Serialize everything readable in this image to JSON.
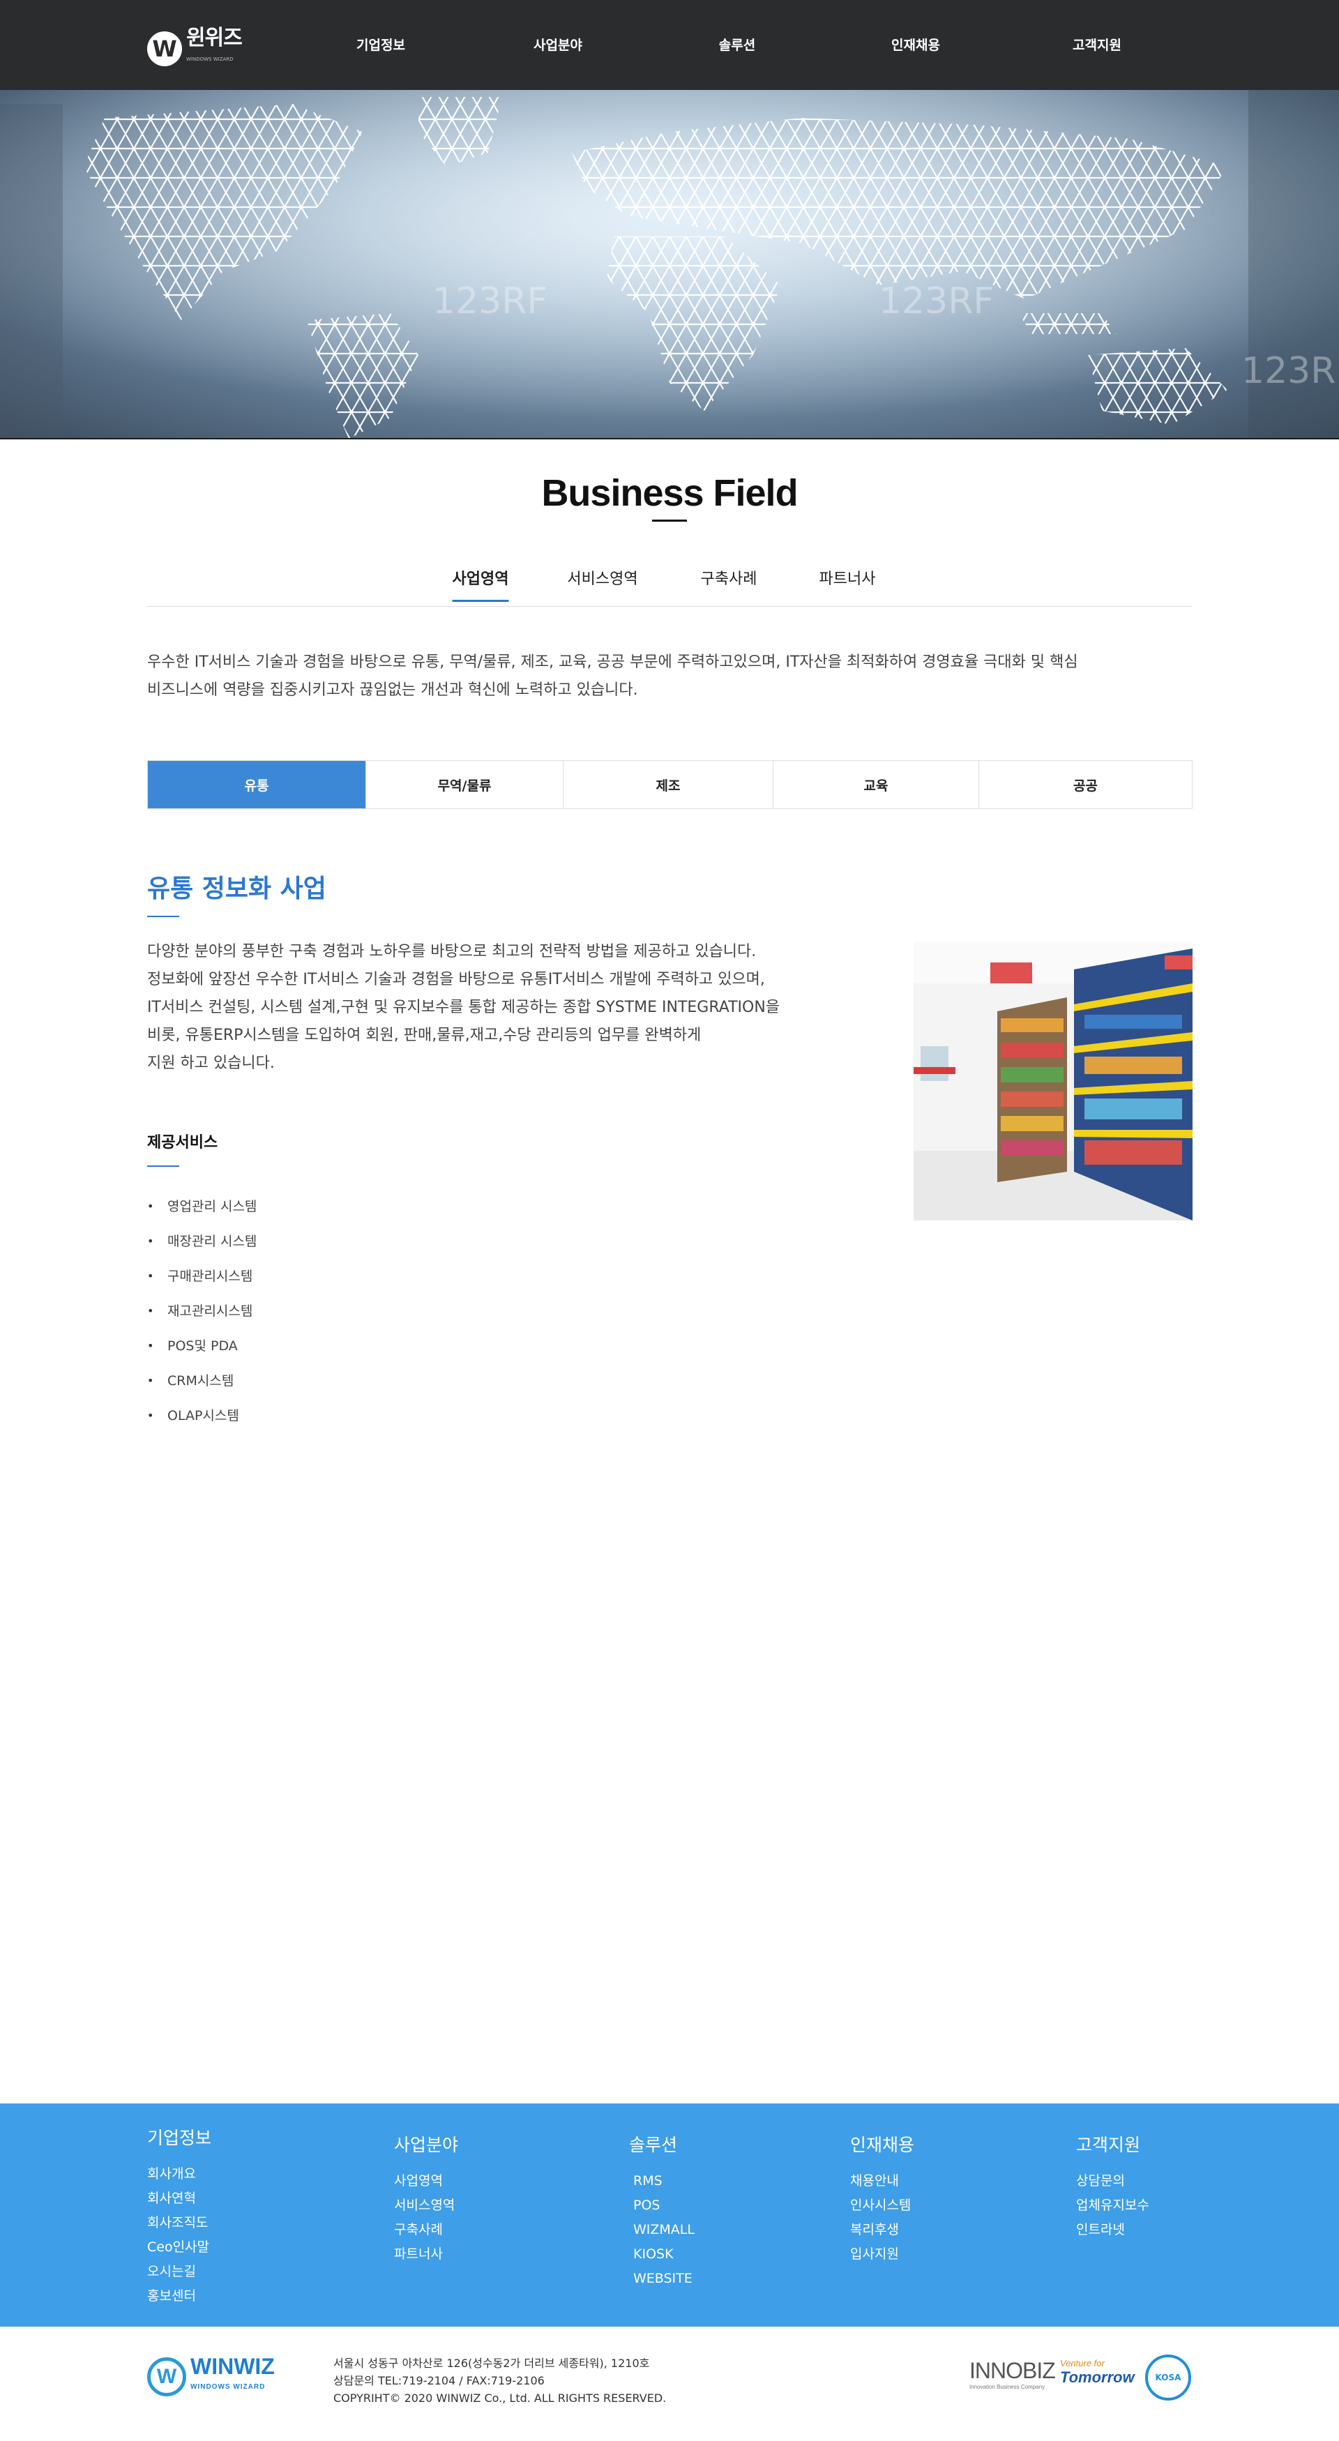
{
  "header": {
    "logo_letter": "W",
    "logo_text": "윈위즈",
    "logo_sub": "WINDOWS WIZARD",
    "nav": [
      "기업정보",
      "사업분야",
      "솔루션",
      "인재채용",
      "고객지원"
    ]
  },
  "hero": {
    "watermark": "123RF"
  },
  "page": {
    "title": "Business Field",
    "tabs": [
      "사업영역",
      "서비스영역",
      "구축사례",
      "파트너사"
    ],
    "active_tab": "사업영역",
    "intro_line1": "우수한 IT서비스 기술과 경험을 바탕으로 유통, 무역/물류, 제조, 교육, 공공 부문에 주력하고있으며, IT자산을 최적화하여 경영효율 극대화 및 핵심",
    "intro_line2": "비즈니스에 역량을 집중시키고자 끊임없는 개선과 혁신에 노력하고 있습니다."
  },
  "subtabs": [
    "유통",
    "무역/물류",
    "제조",
    "교육",
    "공공"
  ],
  "active_subtab": "유통",
  "section": {
    "title": "유통 정보화 사업",
    "desc": [
      "다양한 분야의 풍부한 구축 경험과 노하우를 바탕으로 최고의 전략적 방법을 제공하고 있습니다.",
      "정보화에 앞장선 우수한 IT서비스 기술과 경험을 바탕으로 유통IT서비스 개발에 주력하고 있으며,",
      "IT서비스 컨설팅, 시스템 설계,구현 및 유지보수를 통합 제공하는 종합 SYSTME INTEGRATION을",
      "비롯, 유통ERP시스템을 도입하여 회원, 판매,물류,재고,수당 관리등의 업무를 완벽하게",
      "지원 하고 있습니다."
    ],
    "services_title": "제공서비스",
    "services": [
      "영업관리 시스템",
      "매장관리 시스템",
      "구매관리시스템",
      "재고관리시스템",
      "POS및 PDA",
      "CRM시스템",
      "OLAP시스템"
    ]
  },
  "footer": {
    "columns": [
      {
        "title": "기업정보",
        "links": [
          "회사개요",
          "회사연혁",
          "회사조직도",
          "Ceo인사말",
          "오시는길",
          "홍보센터"
        ]
      },
      {
        "title": "사업분야",
        "links": [
          "사업영역",
          "서비스영역",
          "구축사례",
          "파트너사"
        ]
      },
      {
        "title": "솔루션",
        "links": [
          "RMS",
          "POS",
          "WIZMALL",
          "KIOSK",
          "WEBSITE"
        ]
      },
      {
        "title": "인재채용",
        "links": [
          "채용안내",
          "인사시스템",
          "복리후생",
          "입사지원"
        ]
      },
      {
        "title": "고객지원",
        "links": [
          "상담문의",
          "업체유지보수",
          "인트라넷"
        ]
      }
    ],
    "bottom_logo": "WINWIZ",
    "bottom_logo_sub": "WINDOWS WIZARD",
    "address": "서울시 성동구 아차산로 126(성수동2가 더리브 세종타워), 1210호",
    "contact": "상담문의 TEL:719-2104 / FAX:719-2106",
    "copyright": "COPYRIHT© 2020 WINWIZ Co., Ltd. ALL RIGHTS RESERVED.",
    "cert1": "INNOBIZ",
    "cert1_sub": "Innovation Business Company",
    "cert2_top": "Venture for",
    "cert2": "Tomorrow",
    "cert3": "KOSA"
  }
}
